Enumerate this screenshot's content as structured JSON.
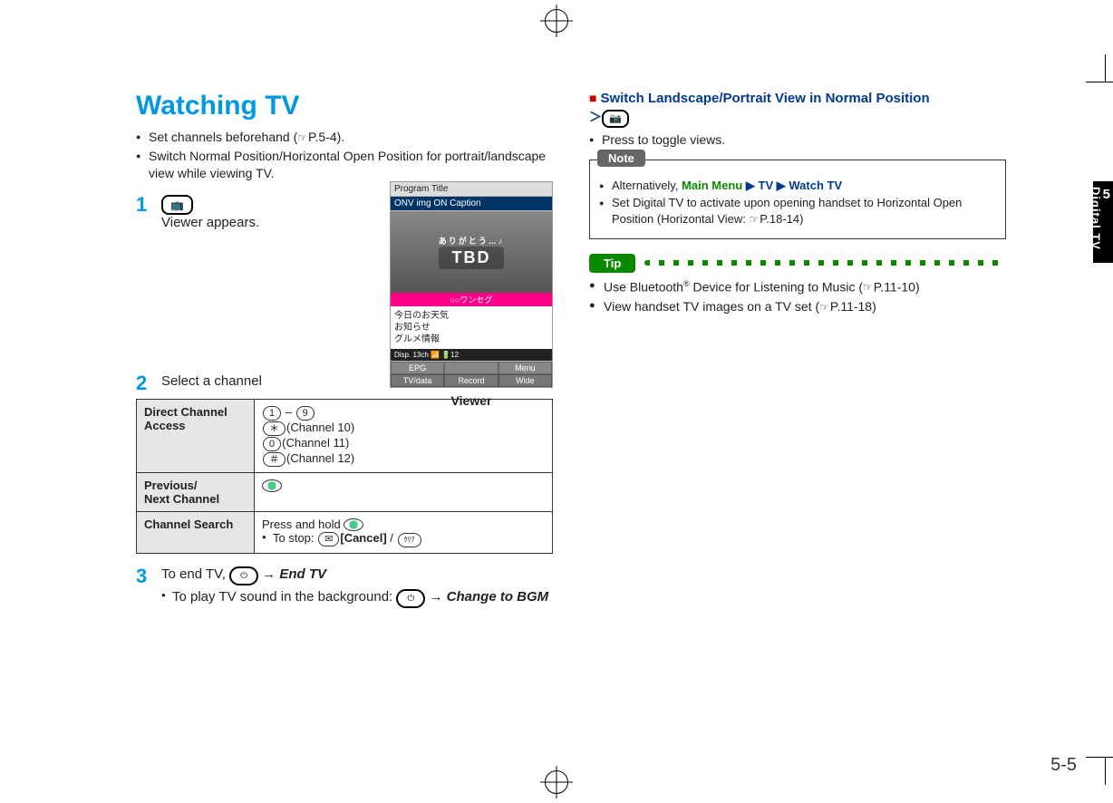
{
  "page": {
    "number": "5-5",
    "side_tab_chapter": "5",
    "side_tab_label": "Digital TV"
  },
  "left": {
    "title": "Watching TV",
    "intro": [
      {
        "text": "Set channels beforehand (",
        "ref": "P.5-4",
        "suffix": ")."
      },
      {
        "text": "Switch Normal Position/Horizontal Open Position for portrait/landscape view while viewing TV."
      }
    ],
    "step1": {
      "num": "1",
      "caption": "Viewer appears."
    },
    "viewer": {
      "label": "Viewer",
      "program_title": "Program Title",
      "onv": "ONV img ON Caption",
      "arigato": "ありがとう…♪",
      "tbd": "TBD",
      "banner": "○○ワンセグ",
      "lines": [
        "今日のお天気",
        "お知らせ",
        "グルメ情報"
      ],
      "status": "Disp.    13ch   📶  🔋12",
      "softkeys1": [
        "EPG",
        "",
        "Menu"
      ],
      "softkeys2": [
        "TV/data",
        "Record",
        "Wide"
      ]
    },
    "step2": {
      "num": "2",
      "text": "Select a channel"
    },
    "table": {
      "row1": {
        "head": "Direct Channel Access",
        "range_sep": " – ",
        "ch10": "(Channel 10)",
        "ch11": "(Channel 11)",
        "ch12": "(Channel 12)"
      },
      "row2": {
        "head": "Previous/\nNext Channel"
      },
      "row3": {
        "head": "Channel Search",
        "press": "Press and hold ",
        "stop_lead": "To stop: ",
        "cancel": "[Cancel]",
        "slash": " / "
      }
    },
    "step3": {
      "num": "3",
      "lead": "To end TV, ",
      "end_tv": "End TV",
      "sub_lead": "To play TV sound in the background: ",
      "change_bgm": "Change to BGM"
    }
  },
  "right": {
    "switch_head": "Switch Landscape/Portrait View in Normal Position",
    "press_toggle": "Press to toggle views.",
    "note": {
      "label": "Note",
      "alt_lead": "Alternatively, ",
      "main_menu": "Main Menu",
      "tv": "TV",
      "watch_tv": "Watch TV",
      "line2a": "Set Digital TV to activate upon opening handset to Horizontal Open Position (Horizontal View: ",
      "line2_ref": "P.18-14",
      "line2b": ")"
    },
    "tip": {
      "label": "Tip",
      "items": [
        {
          "lead": "Use Bluetooth",
          "sup": "®",
          "tail": " Device for Listening to Music (",
          "ref": "P.11-10",
          "end": ")"
        },
        {
          "lead": "View handset TV images on a TV set (",
          "ref": "P.11-18",
          "end": ")"
        }
      ]
    }
  }
}
